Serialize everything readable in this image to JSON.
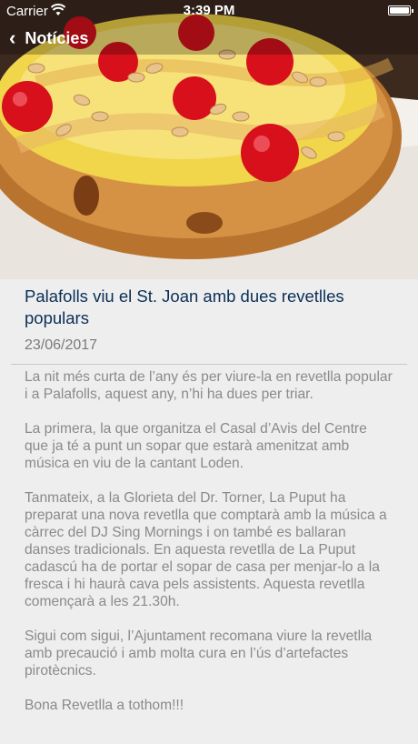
{
  "status_bar": {
    "carrier": "Carrier",
    "time": "3:39 PM"
  },
  "nav": {
    "back_label": "Notícies"
  },
  "hero": {
    "image_icon": "cake-photo"
  },
  "article": {
    "title": "Palafolls viu el St. Joan amb dues revetlles populars",
    "date": "23/06/2017",
    "paragraphs": [
      "La nit més curta de l’any és per viure-la en revetlla popular i a Palafolls, aquest any, n’hi ha dues per triar.",
      "La primera, la que organitza el Casal d’Avis del Centre que ja té a punt un sopar que estarà amenitzat amb música en viu de la cantant Loden.",
      "Tanmateix, a la Glorieta del Dr. Torner, La Puput ha preparat una nova revetlla que comptarà amb la música a càrrec del DJ Sing Mornings i on també es ballaran danses tradicionals. En aquesta revetlla de La Puput cadascú ha de portar el sopar de casa per menjar-lo a la fresca i hi haurà cava pels assistents. Aquesta revetlla començarà a les 21.30h.",
      "Sigui com sigui, l’Ajuntament recomana viure la revetlla amb precaució i amb molta cura en l’ús d’artefactes pirotècnics.",
      "Bona Revetlla a tothom!!!"
    ]
  },
  "colors": {
    "title": "#0a2f57",
    "body_text": "#8a8a8a",
    "background": "#eeeeee"
  }
}
